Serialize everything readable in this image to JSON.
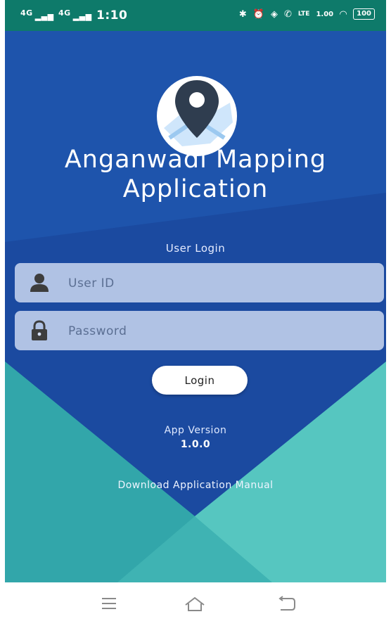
{
  "status_bar": {
    "signal_1": "4G",
    "signal_2": "4G",
    "time": "1:10",
    "net_speed": "1.00",
    "battery": "100"
  },
  "app": {
    "title_line1": "Anganwadi Mapping",
    "title_line2": "Application",
    "login_caption": "User Login"
  },
  "form": {
    "userid_placeholder": "User ID",
    "password_placeholder": "Password",
    "login_label": "Login"
  },
  "footer": {
    "version_label": "App Version",
    "version_value": "1.0.0",
    "manual_link": "Download Application Manual"
  },
  "colors": {
    "status_bar": "#0e7a6a",
    "background_blue": "#1b4aa0",
    "background_teal": "#41b8b5",
    "field_fill": "#d6e0f5"
  },
  "icons": {
    "logo": "map-pin-logo",
    "userid": "user-icon",
    "password": "lock-icon",
    "nav": [
      "menu-icon",
      "home-icon",
      "back-icon"
    ]
  }
}
